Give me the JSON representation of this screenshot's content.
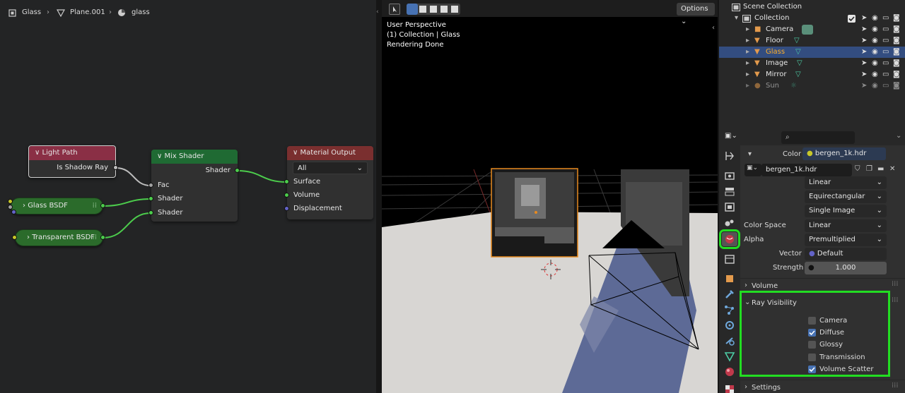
{
  "node_editor": {
    "breadcrumb": [
      "Glass",
      "Plane.001",
      "glass"
    ],
    "nodes": {
      "light_path": {
        "title": "Light Path",
        "output": "Is Shadow Ray"
      },
      "mix_shader": {
        "title": "Mix Shader",
        "output": "Shader",
        "inputs": [
          "Fac",
          "Shader",
          "Shader"
        ]
      },
      "material_output": {
        "title": "Material Output",
        "target": "All",
        "inputs": [
          "Surface",
          "Volume",
          "Displacement"
        ]
      },
      "glass_bsdf": {
        "title": "Glass BSDF"
      },
      "transparent_bsdf": {
        "title": "Transparent BSDF"
      }
    }
  },
  "viewport": {
    "options_label": "Options",
    "overlay": [
      "User Perspective",
      "(1) Collection | Glass",
      "Rendering Done"
    ]
  },
  "outliner": {
    "scene_collection": "Scene Collection",
    "collection": "Collection",
    "items": [
      "Camera",
      "Floor",
      "Glass",
      "Image",
      "Mirror",
      "Sun"
    ],
    "selected": "Glass"
  },
  "properties": {
    "search_placeholder": "",
    "color_label": "Color",
    "color_value": "bergen_1k.hdr",
    "image_name": "bergen_1k.hdr",
    "interpolation": "Linear",
    "projection": "Equirectangular",
    "source": "Single Image",
    "color_space_label": "Color Space",
    "color_space_value": "Linear",
    "alpha_label": "Alpha",
    "alpha_value": "Premultiplied",
    "vector_label": "Vector",
    "vector_value": "Default",
    "strength_label": "Strength",
    "strength_value": "1.000",
    "volume_panel": "Volume",
    "ray_visibility_panel": "Ray Visibility",
    "ray_visibility": [
      {
        "label": "Camera",
        "checked": false
      },
      {
        "label": "Diffuse",
        "checked": true
      },
      {
        "label": "Glossy",
        "checked": false
      },
      {
        "label": "Transmission",
        "checked": false
      },
      {
        "label": "Volume Scatter",
        "checked": true
      }
    ],
    "settings_panel": "Settings"
  },
  "colors": {
    "highlight": "#22dd22",
    "selection": "#334d80",
    "node_green": "#2b6b2b",
    "output_header": "#7a2f2f",
    "input_header": "#8a2f45",
    "mix_header": "#1f6a33"
  }
}
